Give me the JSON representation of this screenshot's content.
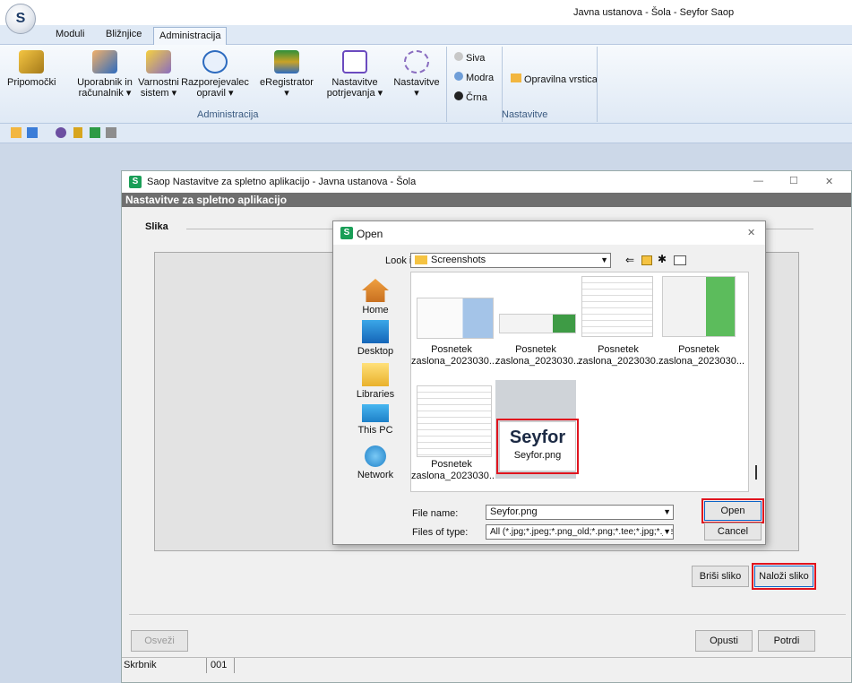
{
  "app": {
    "title": "Javna ustanova - Šola - Seyfor Saop",
    "logo_letter": "S"
  },
  "menu": {
    "tabs": [
      "Moduli",
      "Bližnjice",
      "Administracija"
    ]
  },
  "ribbon": {
    "buttons": [
      {
        "label": "Pripomočki",
        "sub": ""
      },
      {
        "label": "Uporabnik in",
        "sub": "računalnik ▾"
      },
      {
        "label": "Varnostni",
        "sub": "sistem ▾"
      },
      {
        "label": "Razporejevalec",
        "sub": "opravil ▾"
      },
      {
        "label": "eRegistrator",
        "sub": "▾"
      },
      {
        "label": "Nastavitve",
        "sub": "potrjevanja ▾"
      },
      {
        "label": "Nastavitve",
        "sub": "▾"
      }
    ],
    "group_admin": "Administracija",
    "themes": [
      "Siva",
      "Modra",
      "Črna"
    ],
    "opravilna": "Opravilna vrstica",
    "group_settings": "Nastavitve"
  },
  "window": {
    "title": "Saop Nastavitve za spletno aplikacijo - Javna ustanova - Šola",
    "header": "Nastavitve za spletno aplikacijo",
    "section": "Slika",
    "btn_delete": "Briši sliko",
    "btn_upload": "Naloži sliko",
    "btn_refresh": "Osveži",
    "btn_cancel": "Opusti",
    "btn_confirm": "Potrdi",
    "status_user": "Skrbnik",
    "status_code": "001",
    "controls": {
      "min": "—",
      "max": "☐",
      "close": "✕"
    }
  },
  "dialog": {
    "title": "Open",
    "look_in_label": "Look in:",
    "look_in_value": "Screenshots",
    "places": [
      "Home",
      "Desktop",
      "Libraries",
      "This PC",
      "Network"
    ],
    "files": [
      {
        "line1": "Posnetek",
        "line2": "zaslona_2023030..."
      },
      {
        "line1": "Posnetek",
        "line2": "zaslona_2023030..."
      },
      {
        "line1": "Posnetek",
        "line2": "zaslona_2023030..."
      },
      {
        "line1": "Posnetek",
        "line2": "zaslona_2023030..."
      },
      {
        "line1": "Posnetek",
        "line2": "zaslona_2023030..."
      },
      {
        "line1": "Seyfor.png",
        "line2": ""
      }
    ],
    "logo_text": "Seyfor",
    "file_name_label": "File name:",
    "file_name_value": "Seyfor.png",
    "file_type_label": "Files of type:",
    "file_type_value": "All (*.jpg;*.jpeg;*.png_old;*.png;*.tee;*.jpg;*.jpeg",
    "btn_open": "Open",
    "btn_cancel": "Cancel",
    "close": "✕"
  },
  "colors": {
    "accent_red": "#e0141e",
    "brand_green": "#1a9e57"
  }
}
